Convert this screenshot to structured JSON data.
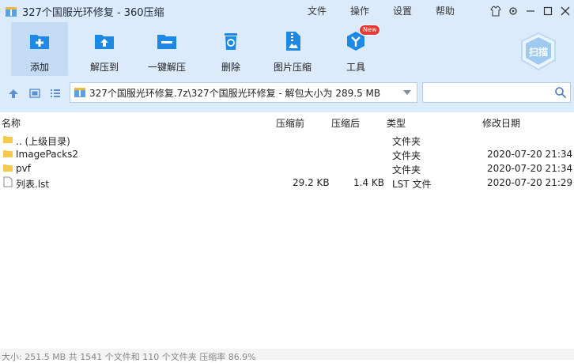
{
  "window": {
    "title": "327个国服光环修复 - 360压缩",
    "menu": [
      "文件",
      "操作",
      "设置",
      "帮助"
    ]
  },
  "toolbar": {
    "items": [
      {
        "label": "添加",
        "icon": "add-folder-icon"
      },
      {
        "label": "解压到",
        "icon": "extract-icon"
      },
      {
        "label": "一键解压",
        "icon": "one-click-extract-icon"
      },
      {
        "label": "删除",
        "icon": "delete-icon"
      },
      {
        "label": "图片压缩",
        "icon": "image-compress-icon"
      },
      {
        "label": "工具",
        "icon": "tools-icon",
        "badge": "New"
      }
    ],
    "scan_label": "扫描"
  },
  "address": {
    "path": "327个国服光环修复.7z\\327个国服光环修复 - 解包大小为 289.5 MB"
  },
  "columns": {
    "name": "名称",
    "compressed_before": "压缩前",
    "compressed_after": "压缩后",
    "type": "类型",
    "modified": "修改日期"
  },
  "files": [
    {
      "name": ".. (上级目录)",
      "size": "",
      "packed": "",
      "type": "文件夹",
      "date": "",
      "kind": "folder"
    },
    {
      "name": "ImagePacks2",
      "size": "",
      "packed": "",
      "type": "文件夹",
      "date": "2020-07-20 21:34",
      "kind": "folder"
    },
    {
      "name": "pvf",
      "size": "",
      "packed": "",
      "type": "文件夹",
      "date": "2020-07-20 21:34",
      "kind": "folder"
    },
    {
      "name": "列表.lst",
      "size": "29.2 KB",
      "packed": "1.4 KB",
      "type": "LST 文件",
      "date": "2020-07-20 21:29",
      "kind": "file"
    }
  ],
  "status": {
    "text": "大小: 251.5 MB 共 1541 个文件和 110 个文件夹 压缩率 86.9%"
  },
  "colors": {
    "accent": "#1e88e5",
    "toolbar_bg": "#dcebfb",
    "folder": "#f7c948",
    "badge": "#e53935"
  }
}
